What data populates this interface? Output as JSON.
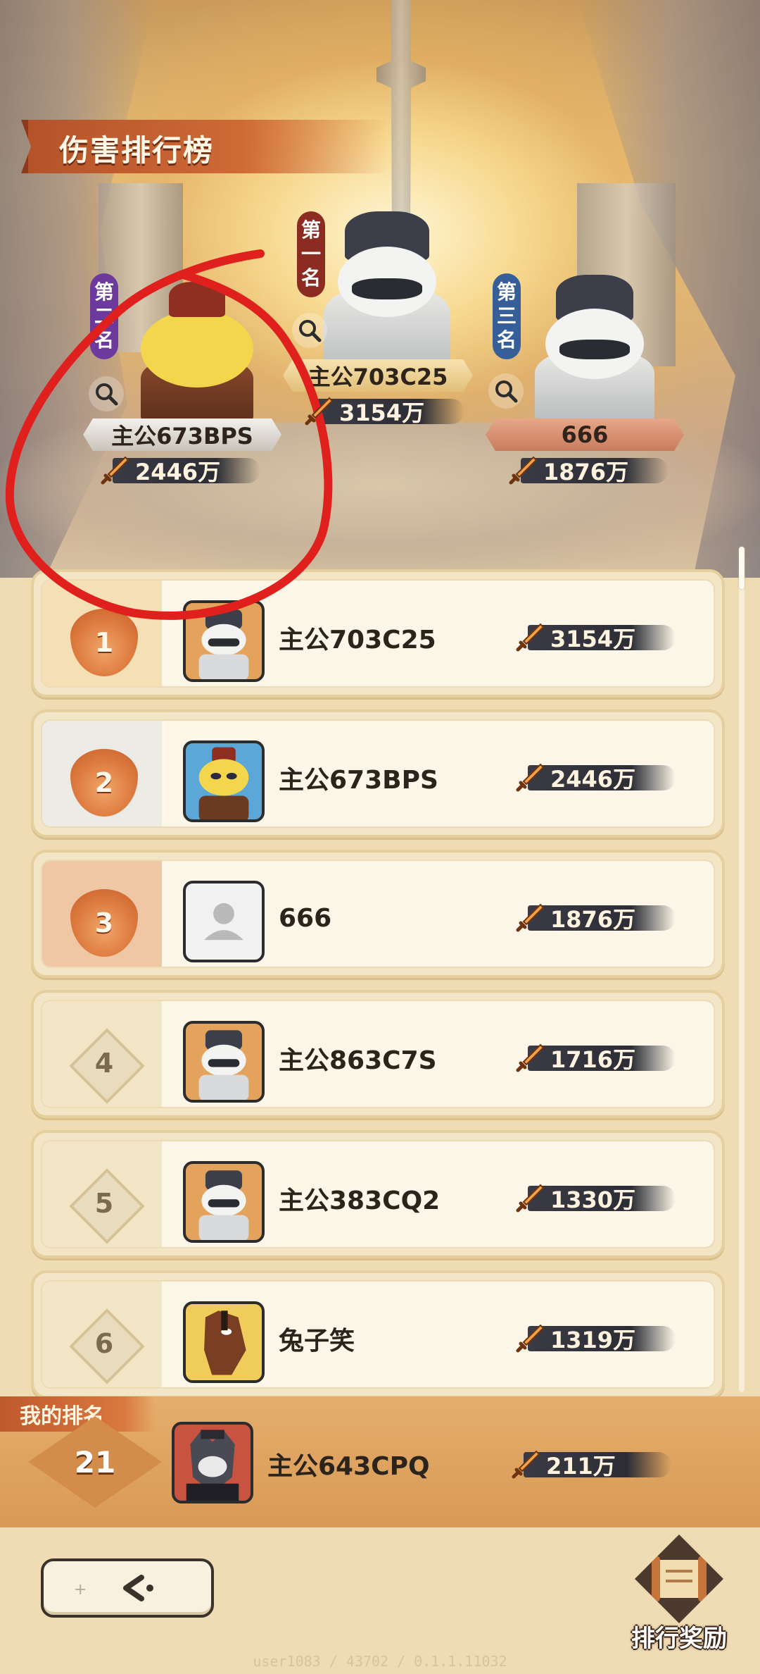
{
  "header": {
    "title": "伤害排行榜"
  },
  "podium": {
    "first": {
      "place_chars": [
        "第",
        "一",
        "名"
      ],
      "name": "主公703C25",
      "power": "3154万"
    },
    "second": {
      "place_chars": [
        "第",
        "二",
        "名"
      ],
      "name": "主公673BPS",
      "power": "2446万"
    },
    "third": {
      "place_chars": [
        "第",
        "三",
        "名"
      ],
      "name": "666",
      "power": "1876万"
    }
  },
  "rows": [
    {
      "rank": "1",
      "name": "主公703C25",
      "power": "3154万",
      "avatar": "penguin-avatar"
    },
    {
      "rank": "2",
      "name": "主公673BPS",
      "power": "2446万",
      "avatar": "cat-avatar"
    },
    {
      "rank": "3",
      "name": "666",
      "power": "1876万",
      "avatar": "default-avatar"
    },
    {
      "rank": "4",
      "name": "主公863C7S",
      "power": "1716万",
      "avatar": "penguin-avatar"
    },
    {
      "rank": "5",
      "name": "主公383CQ2",
      "power": "1330万",
      "avatar": "penguin-avatar"
    },
    {
      "rank": "6",
      "name": "兔子笑",
      "power": "1319万",
      "avatar": "horse-avatar"
    }
  ],
  "my_rank": {
    "label": "我的排名",
    "rank": "21",
    "name": "主公643CPQ",
    "power": "211万",
    "avatar": "wolf-avatar"
  },
  "bottom": {
    "reward_label": "排行奖励",
    "footer": "user1083 / 43702 / 0.1.1.11032"
  },
  "colors": {
    "accent": "#cf6a36",
    "annotation": "#e0201c",
    "power_bar": "#2c2d35"
  }
}
